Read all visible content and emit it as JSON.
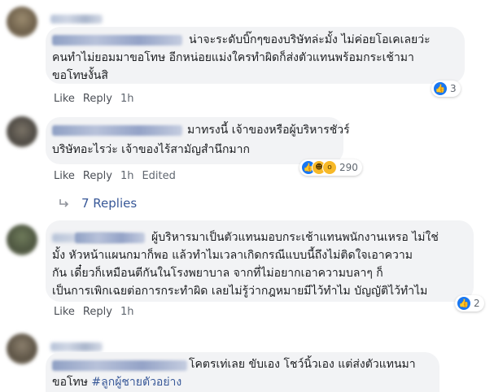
{
  "comments": [
    {
      "text_line1": "น่าจะระดับบิ๊กๆของบริษัทล่ะมั้ง ไม่ค่อยโอเคเลยว่ะ",
      "text_line2": "คนทำไม่ยอมมาขอโทษ อีกหน่อยแม่งใครทำผิดก็ส่งตัวแทนพร้อมกระเช้ามา",
      "text_line3": "ขอโทษงั้นสิ",
      "like": "Like",
      "reply": "Reply",
      "time": "1h",
      "reaction_count": "3"
    },
    {
      "text_line1": "มาทรงนี้ เจ้าของหรือผู้บริหารชัวร์",
      "text_line2": "บริษัทอะไรว่ะ เจ้าของไร้สามัญสำนึกมาก",
      "like": "Like",
      "reply": "Reply",
      "time": "1h",
      "edited": "Edited",
      "reaction_count": "290"
    },
    {
      "text_line1": "ผู้บริหารมาเป็นตัวแทนมอบกระเช้าแทนพนักงานเหรอ ไม่ใช่",
      "text_line2": "มั้ง หัวหน้าแผนกมาก็พอ แล้วทำไมเวลาเกิดกรณีแบบนี้ถึงไม่ติดใจเอาความ",
      "text_line3": "กัน เดี๋ยวก็เหมือนตีกันในโรงพยาบาล จากที่ไม่อยากเอาความบลาๆ ก็",
      "text_line4": "เป็นการเพิกเฉยต่อการกระทำผิด เลยไม่รู้ว่ากฎหมายมีไว้ทำไม บัญญัติไว้ทำไม",
      "like": "Like",
      "reply": "Reply",
      "time": "1h",
      "reaction_count": "2"
    },
    {
      "text_line1": "โคตรเท่เลย ขับเอง โชว์นิ้วเอง แต่ส่งตัวแทนมา",
      "text_line2": "ขอโทษ",
      "hashtag": "#ลูกผู้ชายตัวอย่าง"
    }
  ],
  "replies_link": "7 Replies",
  "colors": {
    "link": "#385898",
    "bubble": "#f2f3f5",
    "like_blue": "#1877f2"
  },
  "icons": [
    "like-reaction-icon",
    "haha-reaction-icon",
    "wow-reaction-icon",
    "reply-arrow-icon"
  ]
}
